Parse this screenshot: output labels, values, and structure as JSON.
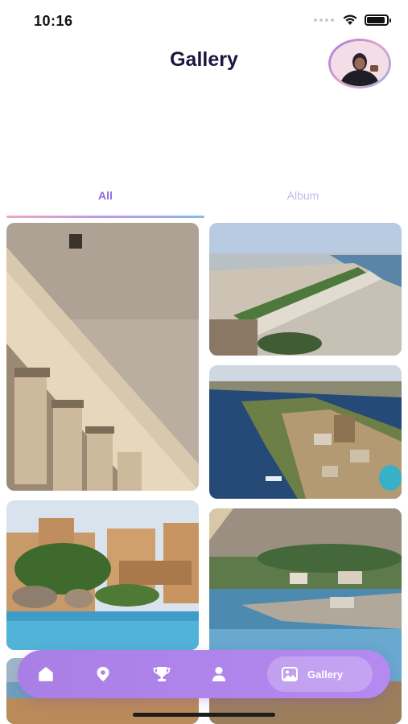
{
  "status": {
    "time": "10:16",
    "battery_level": 0.9,
    "icons": [
      "cellular-dots-icon",
      "wifi-icon",
      "battery-icon"
    ]
  },
  "header": {
    "title": "Gallery",
    "avatar": "profile-avatar"
  },
  "tabs": [
    {
      "label": "All",
      "active": true
    },
    {
      "label": "Album",
      "active": false
    }
  ],
  "gallery": {
    "photos": [
      {
        "name": "temple-columns-photo"
      },
      {
        "name": "dam-aerial-photo"
      },
      {
        "name": "island-resort-aerial-photo"
      },
      {
        "name": "philae-temple-photo"
      },
      {
        "name": "nile-village-photo"
      },
      {
        "name": "nile-boats-photo"
      }
    ]
  },
  "bottom_nav": {
    "items": [
      {
        "icon": "home-icon"
      },
      {
        "icon": "location-pin-icon"
      },
      {
        "icon": "trophy-icon"
      },
      {
        "icon": "user-icon"
      },
      {
        "icon": "image-icon",
        "label": "Gallery",
        "active": true
      }
    ]
  },
  "colors": {
    "accent": "#8c6de0",
    "nav_background": "#ab82e8",
    "title": "#1a1740",
    "tab_inactive": "#c6b9ee"
  }
}
